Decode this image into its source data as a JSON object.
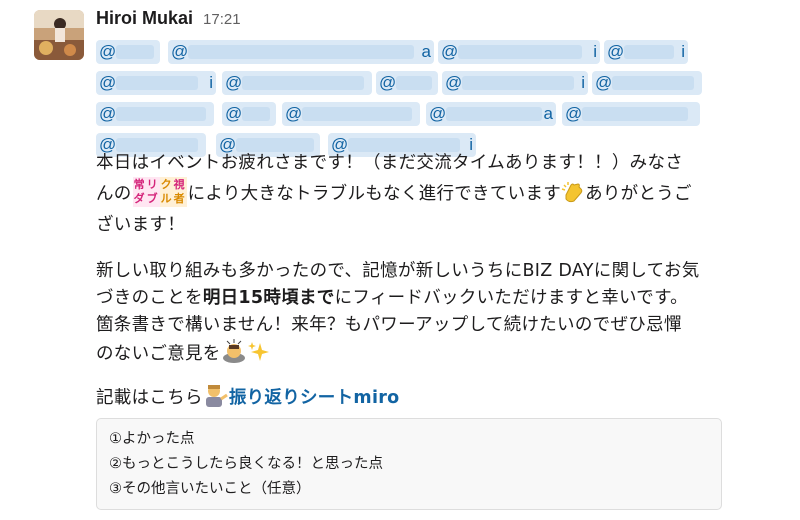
{
  "message": {
    "sender": "Hiroi Mukai",
    "time": "17:21",
    "mentions": {
      "row1": [
        {
          "tail": "a"
        },
        {
          "tail": "i"
        },
        {
          "tail": "i"
        }
      ],
      "row2": [
        {
          "tail": "i"
        },
        {
          "tail": ""
        },
        {
          "tail": "i"
        }
      ],
      "row3": [
        {
          "tail": ""
        },
        {
          "tail": "a"
        },
        {
          "tail": "a"
        }
      ],
      "row4": [
        {
          "tail": ""
        },
        {
          "tail": "i"
        }
      ]
    },
    "at_symbol": "@",
    "p1_a": "本日はイベントお疲れさまです！（まだ交流タイムあります！！）みなさ",
    "p1_b1": "んの",
    "stamp_chars": {
      "c1": "常",
      "c2": "リ",
      "c3": "ク",
      "c4": "視",
      "c5": "ダ",
      "c6": "ブ",
      "c7": "ル",
      "c8": "点",
      "c9": "者"
    },
    "p1_b2": "により大きなトラブルもなく進行できています",
    "p1_b3": "ありがとうご",
    "p1_c": "ざいます！",
    "p2_a": "新しい取り組みも多かったので、記憶が新しいうちにBIZ DAYに関してお気",
    "p2_b1": "づきのことを",
    "p2_b_bold": "明日15時頃まで",
    "p2_b2": "にフィードバックいただけますと幸いです。",
    "p2_c": "箇条書きで構いません！来年？もパワーアップして続けたいのでぜひ忌憚",
    "p2_d": "のないご意見を",
    "p3_text": "記載はこちら",
    "p3_link": "振り返りシートmiro",
    "code_lines": [
      "①よかった点",
      "②もっとこうしたら良くなる！と思った点",
      "③その他言いたいこと（任意）"
    ]
  }
}
